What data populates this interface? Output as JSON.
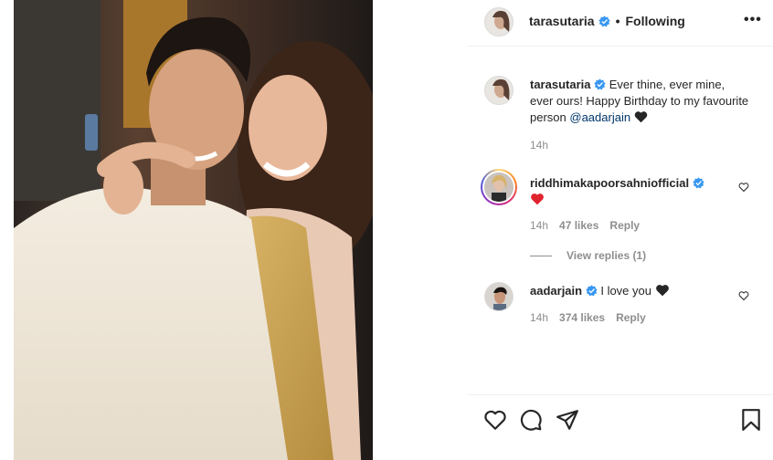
{
  "post": {
    "owner": "tarasutaria",
    "follow_separator": "•",
    "follow_status": "Following",
    "more_label": "•••"
  },
  "caption": {
    "username": "tarasutaria",
    "text": "Ever thine, ever mine, ever ours! Happy Birthday to my favourite person",
    "mention": "@aadarjain",
    "emoji": "black-heart",
    "time": "14h"
  },
  "comments": [
    {
      "username": "riddhimakapoorsahniofficial",
      "text": "",
      "emoji": "red-heart",
      "time": "14h",
      "likes": "47 likes",
      "reply_label": "Reply",
      "view_replies": "View replies (1)"
    },
    {
      "username": "aadarjain",
      "text": "I love you",
      "emoji": "black-heart",
      "time": "14h",
      "likes": "374 likes",
      "reply_label": "Reply"
    }
  ],
  "actions": [
    "like-icon",
    "comment-icon",
    "share-icon",
    "save-icon"
  ],
  "colors": {
    "verified": "#3897f0",
    "text": "#262626",
    "muted": "#8e8e8e",
    "mention": "#00376b",
    "heart_red": "#ed4956"
  }
}
